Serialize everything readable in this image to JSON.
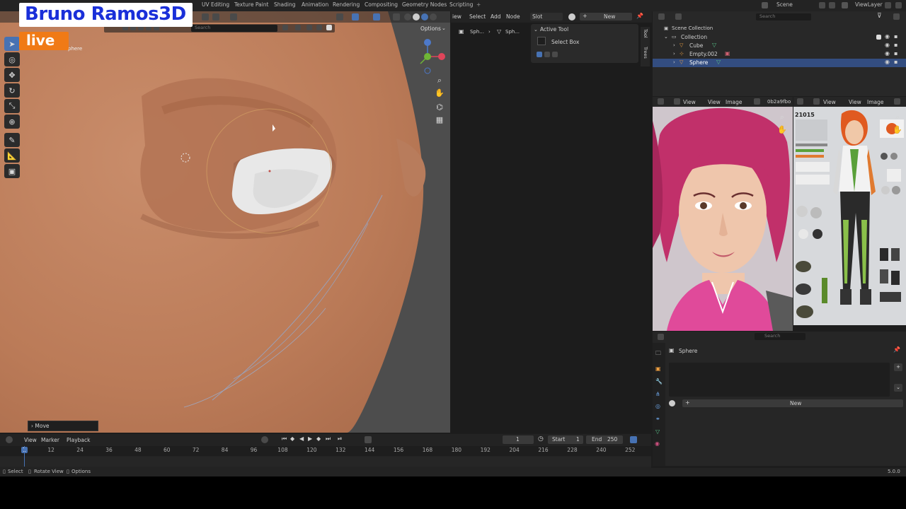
{
  "brand": {
    "logo_text": "Bruno Ramos3D",
    "live_badge": "live"
  },
  "workspace_tabs": [
    "UV Editing",
    "Texture Paint",
    "Shading",
    "Animation",
    "Rendering",
    "Compositing",
    "Geometry Nodes",
    "Scripting"
  ],
  "viewport": {
    "search_placeholder": "Search",
    "options_label": "Options",
    "object_label": "phere",
    "last_op": "Move"
  },
  "node_editor": {
    "menu": [
      "iew",
      "Select",
      "Add",
      "Node"
    ],
    "slot_label": "Slot",
    "new_label": "New",
    "breadcrumb": [
      "Sph...",
      "Sph..."
    ],
    "active_tool_title": "Active Tool",
    "active_tool_name": "Select Box",
    "side_tabs": [
      "Tool",
      "Trees"
    ]
  },
  "outliner": {
    "scene_label": "Scene",
    "viewlayer_label": "ViewLayer",
    "search_placeholder": "Search",
    "scene_collection": "Scene Collection",
    "items": [
      {
        "name": "Collection",
        "indent": 0
      },
      {
        "name": "Cube",
        "indent": 1
      },
      {
        "name": "Empty.002",
        "indent": 1
      },
      {
        "name": "Sphere",
        "indent": 1,
        "selected": true
      }
    ]
  },
  "image_editor_left": {
    "view": "View",
    "view2": "View",
    "image": "Image",
    "file": "0b2a9fbo"
  },
  "image_editor_right": {
    "view": "View",
    "image": "Image",
    "sheet_code": "21015"
  },
  "properties": {
    "search_placeholder": "Search",
    "object_name": "Sphere",
    "new_label": "New"
  },
  "timeline": {
    "menu": [
      "View",
      "Marker",
      "Playback"
    ],
    "current_frame": "1",
    "start_label": "Start",
    "start_value": "1",
    "end_label": "End",
    "end_value": "250",
    "ticks": [
      "1",
      "12",
      "24",
      "36",
      "48",
      "60",
      "72",
      "84",
      "96",
      "108",
      "120",
      "132",
      "144",
      "156",
      "168",
      "180",
      "192",
      "204",
      "216",
      "228",
      "240",
      "252"
    ]
  },
  "status_bar": {
    "select": "Select",
    "rotate": "Rotate View",
    "options": "Options",
    "version": "5.0.0"
  },
  "colors": {
    "accent_blue": "#4772b3",
    "live_orange": "#f07a16",
    "logo_blue": "#1a2fd9",
    "skin": "#c0805e"
  }
}
